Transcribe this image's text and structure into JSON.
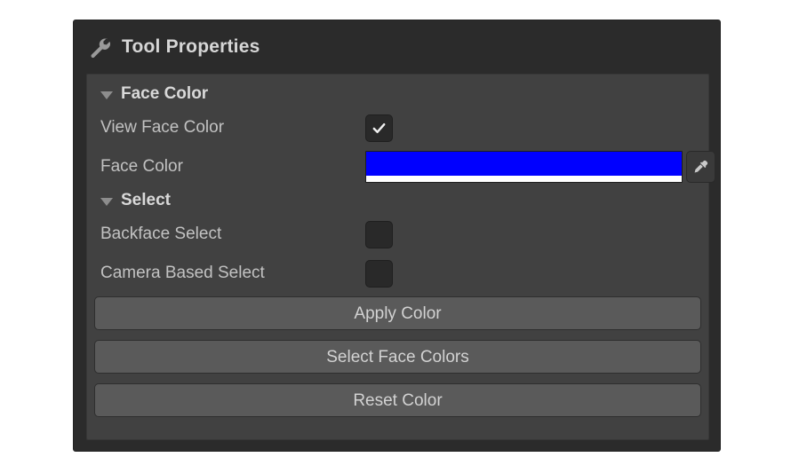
{
  "panel": {
    "title": "Tool Properties",
    "icon": "wrench-icon"
  },
  "sections": [
    {
      "id": "face-color",
      "title": "Face Color",
      "expanded": true,
      "collapse_icon": "triangle-down-icon",
      "rows": [
        {
          "id": "view-face-color",
          "label": "View Face Color",
          "control": "checkbox",
          "checked": true
        },
        {
          "id": "face-color",
          "label": "Face Color",
          "control": "color",
          "color": "#0000FF",
          "alpha_color": "#FFFFFF",
          "picker_icon": "eyedropper-icon"
        }
      ]
    },
    {
      "id": "select",
      "title": "Select",
      "expanded": true,
      "collapse_icon": "triangle-down-icon",
      "rows": [
        {
          "id": "backface-select",
          "label": "Backface Select",
          "control": "checkbox",
          "checked": false
        },
        {
          "id": "camera-based-select",
          "label": "Camera Based Select",
          "control": "checkbox",
          "checked": false
        }
      ]
    }
  ],
  "buttons": [
    {
      "id": "apply-color",
      "label": "Apply Color"
    },
    {
      "id": "select-face-colors",
      "label": "Select Face Colors"
    },
    {
      "id": "reset-color",
      "label": "Reset Color"
    }
  ],
  "colors": {
    "panel_background": "#2B2B2B",
    "content_background": "#414141",
    "button_fill": "#5A5A5A",
    "text": "#C2C2C2",
    "heading_text": "#D9D9D9",
    "accent_swatch": "#0000FF"
  }
}
